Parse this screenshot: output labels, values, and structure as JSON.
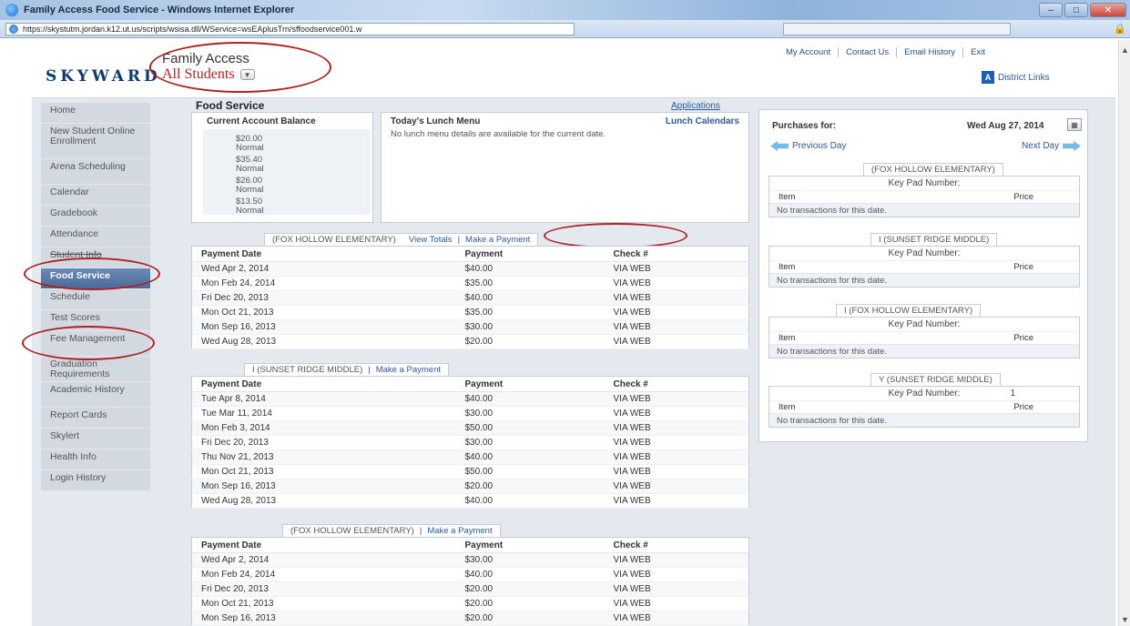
{
  "browser": {
    "title": "Family Access Food Service - Windows Internet Explorer",
    "url": "https://skystutm.jordan.k12.ut.us/scripts/wsisa.dll/WService=wsEAplusTrn/sffoodservice001.w"
  },
  "header": {
    "logo": "SKYWARD",
    "app_name": "Family Access",
    "student_selector": "All Students",
    "top_links": [
      "My Account",
      "Contact Us",
      "Email History",
      "Exit"
    ],
    "district_links": "District Links"
  },
  "sidebar": {
    "items": [
      "Home",
      "New Student Online Enrollment",
      "Arena Scheduling",
      "Calendar",
      "Gradebook",
      "Attendance",
      "Student Info",
      "Food Service",
      "Schedule",
      "Test Scores",
      "Fee Management",
      "Graduation Requirements",
      "Academic History",
      "Report Cards",
      "Skylert",
      "Health Info",
      "Login History"
    ],
    "active": "Food Service"
  },
  "main": {
    "title": "Food Service",
    "applications_link": "Applications",
    "balance": {
      "header": "Current Account Balance",
      "entries": [
        {
          "amount": "$20.00",
          "status": "Normal"
        },
        {
          "amount": "$35.40",
          "status": "Normal"
        },
        {
          "amount": "$26.00",
          "status": "Normal"
        },
        {
          "amount": "$13.50",
          "status": "Normal"
        }
      ]
    },
    "menu": {
      "header": "Today's Lunch Menu",
      "calendars_link": "Lunch Calendars",
      "message": "No lunch menu details are available for the current date."
    },
    "columns": [
      "Payment Date",
      "Payment",
      "Check #"
    ],
    "sections": [
      {
        "school": "(FOX HOLLOW ELEMENTARY)",
        "view_totals": "View Totals",
        "make_payment": "Make a Payment",
        "rows": [
          [
            "Wed Apr 2, 2014",
            "$40.00",
            "VIA WEB"
          ],
          [
            "Mon Feb 24, 2014",
            "$35.00",
            "VIA WEB"
          ],
          [
            "Fri Dec 20, 2013",
            "$40.00",
            "VIA WEB"
          ],
          [
            "Mon Oct 21, 2013",
            "$35.00",
            "VIA WEB"
          ],
          [
            "Mon Sep 16, 2013",
            "$30.00",
            "VIA WEB"
          ],
          [
            "Wed Aug 28, 2013",
            "$20.00",
            "VIA WEB"
          ]
        ]
      },
      {
        "school": "I (SUNSET RIDGE MIDDLE)",
        "make_payment": "Make a Payment",
        "rows": [
          [
            "Tue Apr 8, 2014",
            "$40.00",
            "VIA WEB"
          ],
          [
            "Tue Mar 11, 2014",
            "$30.00",
            "VIA WEB"
          ],
          [
            "Mon Feb 3, 2014",
            "$50.00",
            "VIA WEB"
          ],
          [
            "Fri Dec 20, 2013",
            "$30.00",
            "VIA WEB"
          ],
          [
            "Thu Nov 21, 2013",
            "$40.00",
            "VIA WEB"
          ],
          [
            "Mon Oct 21, 2013",
            "$50.00",
            "VIA WEB"
          ],
          [
            "Mon Sep 16, 2013",
            "$20.00",
            "VIA WEB"
          ],
          [
            "Wed Aug 28, 2013",
            "$40.00",
            "VIA WEB"
          ]
        ]
      },
      {
        "school": "(FOX HOLLOW ELEMENTARY)",
        "make_payment": "Make a Payment",
        "rows": [
          [
            "Wed Apr 2, 2014",
            "$30.00",
            "VIA WEB"
          ],
          [
            "Mon Feb 24, 2014",
            "$40.00",
            "VIA WEB"
          ],
          [
            "Fri Dec 20, 2013",
            "$20.00",
            "VIA WEB"
          ],
          [
            "Mon Oct 21, 2013",
            "$20.00",
            "VIA WEB"
          ],
          [
            "Mon Sep 16, 2013",
            "$20.00",
            "VIA WEB"
          ]
        ]
      }
    ]
  },
  "purchases": {
    "label": "Purchases for:",
    "date": "Wed Aug 27, 2014",
    "prev": "Previous Day",
    "next": "Next Day",
    "key_pad_label": "Key Pad Number:",
    "item_col": "Item",
    "price_col": "Price",
    "no_transactions": "No transactions for this date.",
    "blocks": [
      {
        "school": "(FOX HOLLOW ELEMENTARY)",
        "key_pad": ""
      },
      {
        "school": "I (SUNSET RIDGE MIDDLE)",
        "key_pad": ""
      },
      {
        "school": "I (FOX HOLLOW ELEMENTARY)",
        "key_pad": ""
      },
      {
        "school": "Y (SUNSET RIDGE MIDDLE)",
        "key_pad": "1"
      }
    ]
  },
  "colors": {
    "accent": "#2a5aa0",
    "annotation": "#b02020",
    "active_nav": "#4a6a98"
  }
}
